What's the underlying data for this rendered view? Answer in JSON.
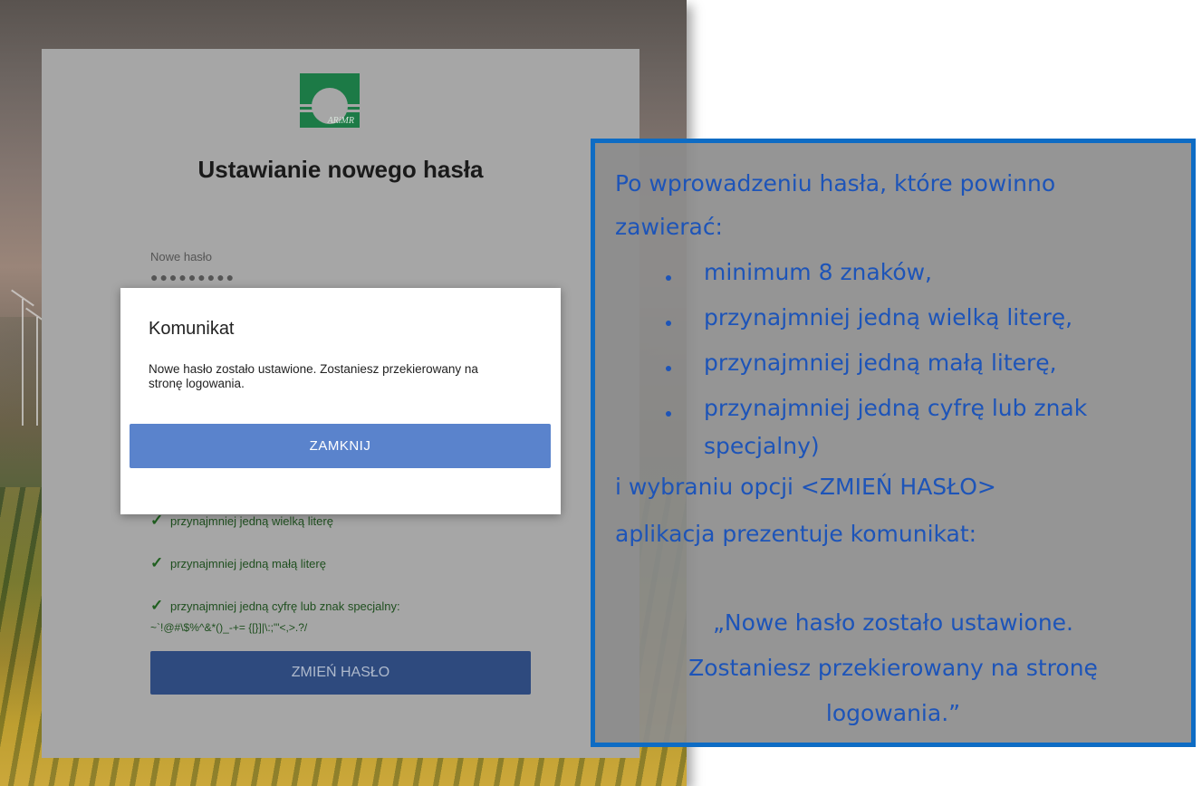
{
  "login_card": {
    "logo_text": "ARiMR",
    "title": "Ustawianie nowego hasła",
    "password_label": "Nowe hasło",
    "password_value": "●●●●●●●●●",
    "requirements": [
      "przynajmniej jedną wielką literę",
      "przynajmniej jedną małą literę",
      "przynajmniej jedną cyfrę lub znak specjalny:"
    ],
    "special_chars": "~`!@#\\$%^&*()_-+= {[}]|\\:;\"'<,>.?/",
    "check_icon": "check-icon",
    "change_button": "ZMIEŃ HASŁO"
  },
  "dialog": {
    "title": "Komunikat",
    "message": "Nowe hasło zostało ustawione. Zostaniesz przekierowany na stronę logowania.",
    "close_button": "ZAMKNIJ"
  },
  "annotation": {
    "intro_line1": "Po wprowadzeniu hasła, które powinno",
    "intro_line2": "zawierać:",
    "items": [
      "minimum 8 znaków,",
      "przynajmniej jedną wielką literę,",
      "przynajmniej jedną małą literę,",
      "przynajmniej jedną cyfrę lub znak"
    ],
    "item_continuation": "specjalny)",
    "outro_line1": "i wybraniu opcji <ZMIEŃ HASŁO>",
    "outro_line2": "aplikacja prezentuje komunikat:",
    "quote_line1": "„Nowe hasło zostało ustawione.",
    "quote_line2": "Zostaniesz przekierowany na stronę",
    "quote_line3": "logowania.”"
  },
  "colors": {
    "annotation_border": "#0e6cc4",
    "annotation_text": "#1d54b8",
    "dialog_button": "#5a83cc",
    "change_button": "#2e4a7e",
    "logo_green": "#1c7a46"
  }
}
